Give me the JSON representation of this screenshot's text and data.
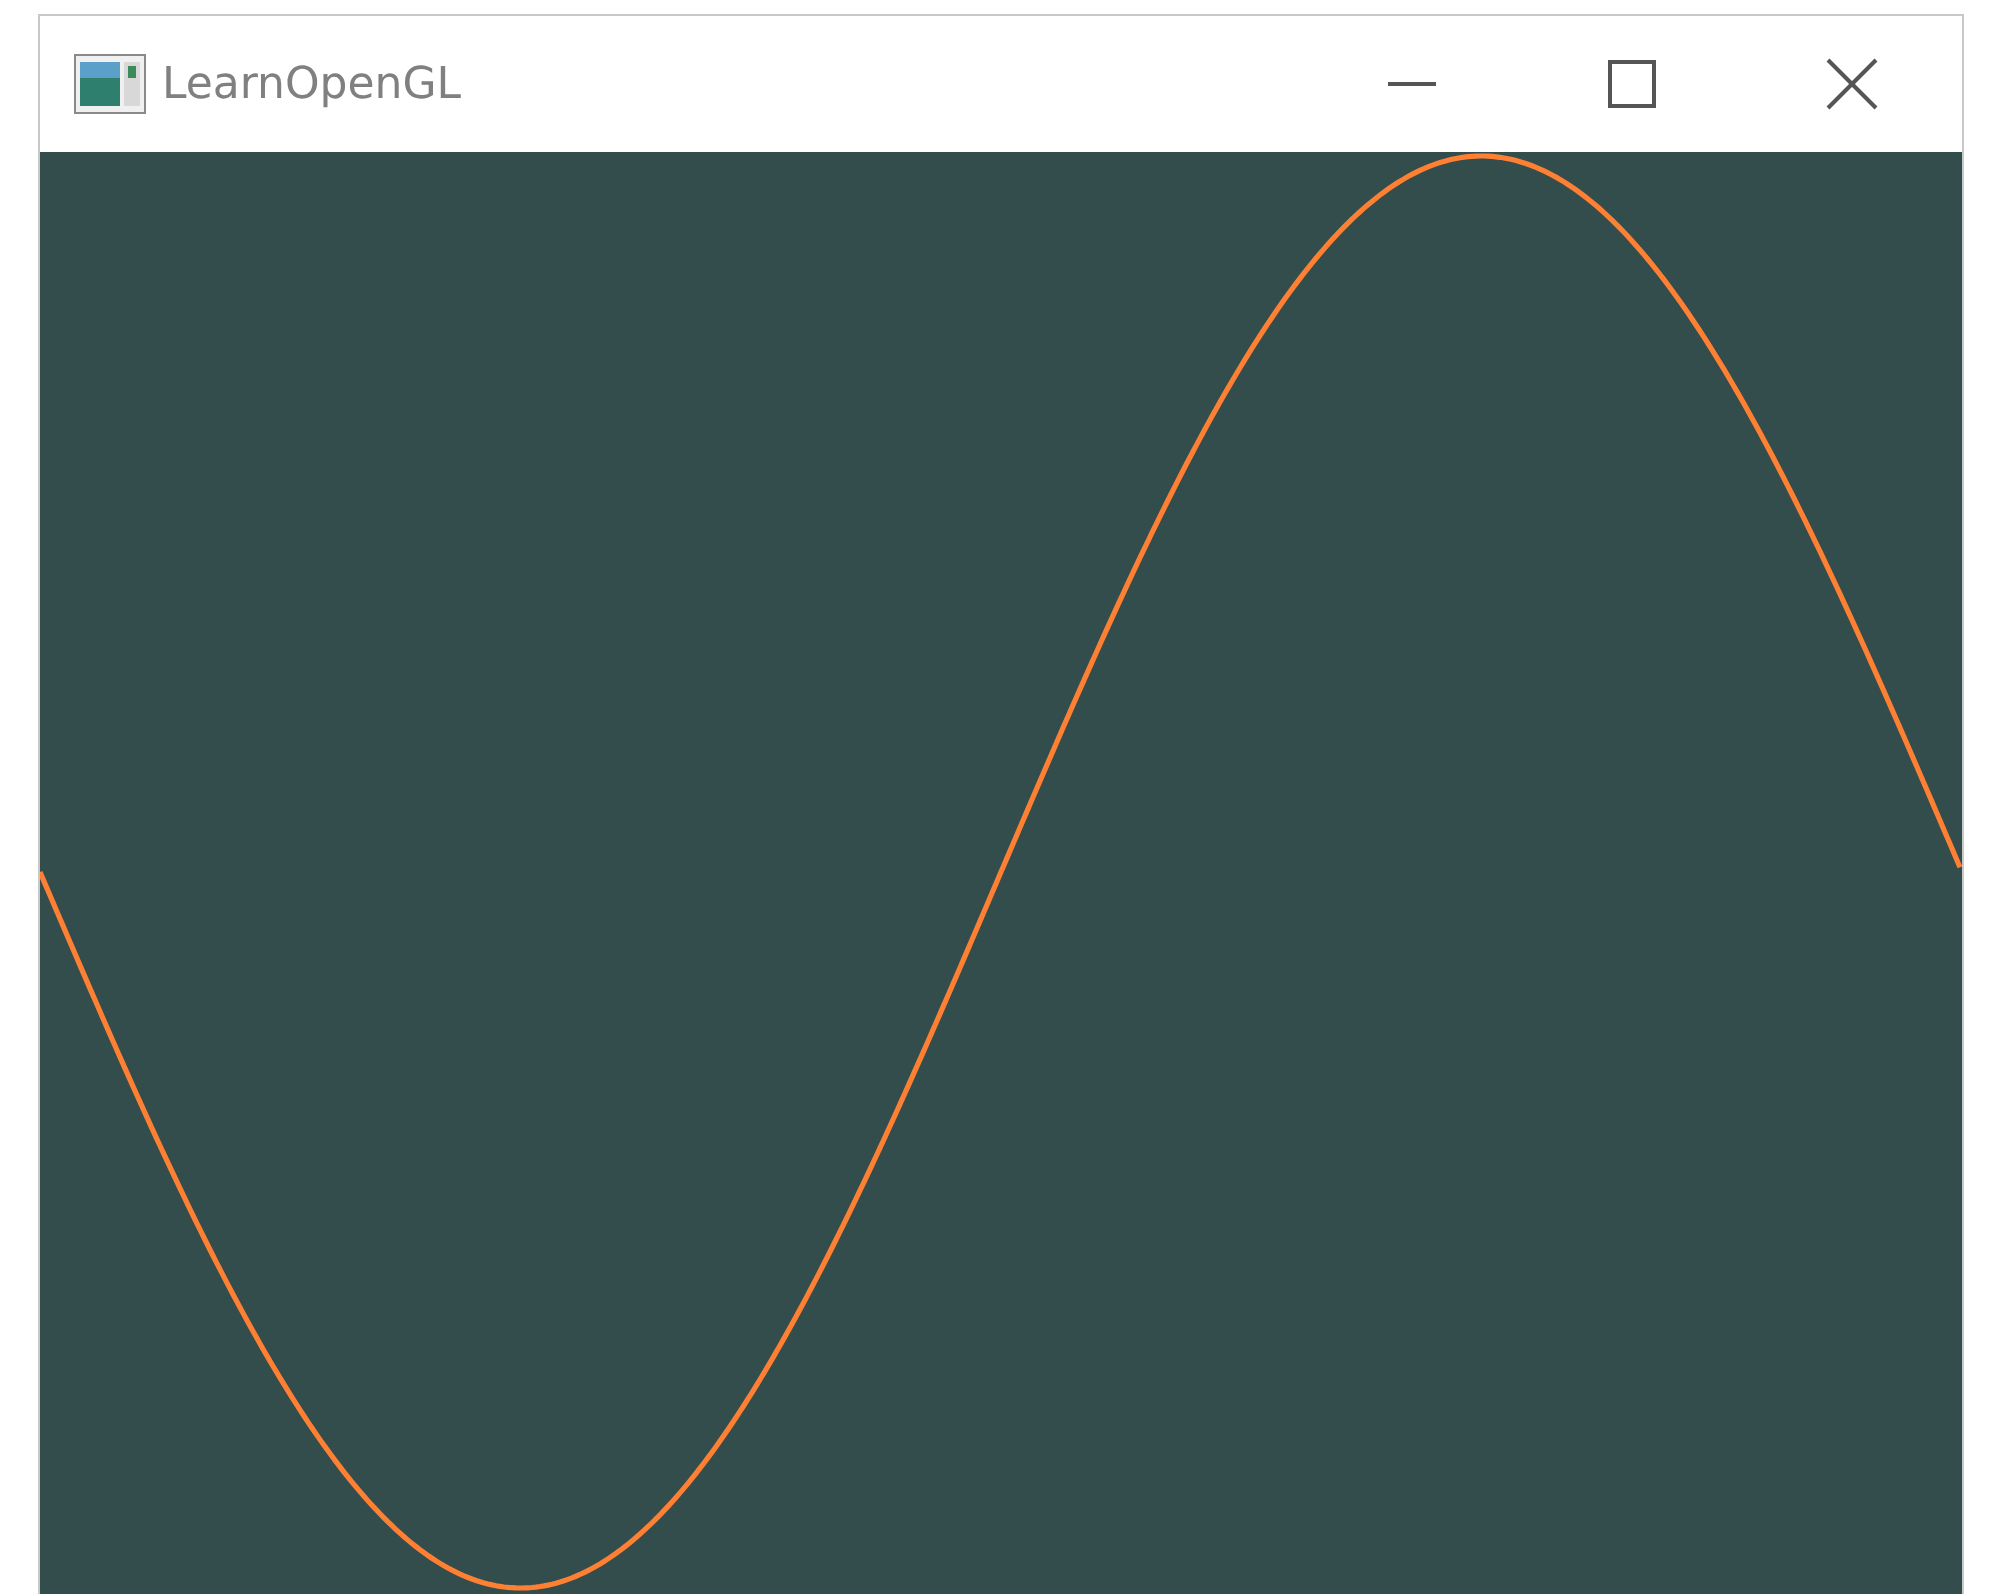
{
  "window": {
    "title": "LearnOpenGL"
  }
}
